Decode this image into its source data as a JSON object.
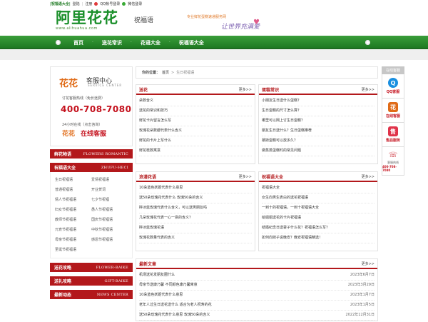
{
  "topbar": {
    "site_link": "|祝福语大全|",
    "login": "登陆",
    "sep": "|",
    "register": "注册",
    "qq_login": "QQ帐号登录",
    "wechat_login": "微信登录"
  },
  "logo": {
    "main": "阿里花花",
    "url": "www.alihuahua.com",
    "flower": "✿"
  },
  "header": {
    "site_name": "祝福语",
    "slogan": "专业鲜花蛋糕速递服务网",
    "banner_text": "让世界充满爱",
    "banner_heart": "♥"
  },
  "nav": {
    "items": [
      "首页",
      "送花常识",
      "花语大全",
      "祝福语大全"
    ],
    "dot": "·"
  },
  "service": {
    "logo": "花花",
    "title": "客服中心",
    "title_en": "SERVICE CENTER",
    "hotline_label": "订花客服热线（免长途费）",
    "phone": "400-708-7080",
    "online_label": "24小时在线（点击咨询）",
    "logo2": "花花",
    "online_btn": "在线客服"
  },
  "left_bars": [
    {
      "cn": "鲜花物语",
      "en": "FLOWERS ROMANTIC"
    },
    {
      "cn": "祝福语大全",
      "en": "ZHUFU-HECI"
    },
    {
      "cn": "送花攻略",
      "en": "FLOWER-BAIKE"
    },
    {
      "cn": "送礼攻略",
      "en": "GIFT-BAIKE"
    },
    {
      "cn": "最新动态",
      "en": "NEWS CENTER"
    }
  ],
  "tags": [
    "生日祝福语",
    "爱情祝福语",
    "普通祝福语",
    "开业贺词",
    "情人节祝福语",
    "七夕节祝福",
    "妇女节祝福语",
    "愚人节祝福语",
    "教师节祝福语",
    "国庆节祝福语",
    "元宵节祝福语",
    "中秋节祝福语",
    "母亲节祝福语",
    "感恩节祝福语",
    "圣诞节祝福语"
  ],
  "crumb": {
    "label": "你的位置：",
    "home": "首页",
    "arrow": ">",
    "current": "生日祝福语"
  },
  "more": "更多>>",
  "panels": [
    {
      "title": "送花",
      "items": [
        "朵数含义",
        "送花的常识和技巧",
        "鲜花卡片留言怎么写",
        "玫瑰花朵数都代表什么含义",
        "鲜花的卡片上写什么",
        "鲜花枝数寓意"
      ]
    },
    {
      "title": "蛋糕常识",
      "items": [
        "小朋友生日送什么蛋糕？",
        "生日蛋糕的尺寸怎么算？",
        "哪里可以网上订生日蛋糕？",
        "朋友生日送什么？生日蛋糕推荐",
        "慕斯蛋糕可以放多久？",
        "做蒸蒸蛋糕时的常见问题"
      ]
    },
    {
      "title": "浪漫花语",
      "items": [
        "10朵蓝色妖姬代表什么意思",
        "送50朵玫瑰花代表什么 玫瑰50朵的含义",
        "碎冰蓝玫瑰代表什么含义，可以送男朋友吗",
        "几朵玫瑰花代表一心一意的含义？",
        "碎冰蓝玫瑰花语",
        "玫瑰花数量代表的含义"
      ]
    },
    {
      "title": "祝福语大全",
      "items": [
        "祝福语大全",
        "女生向男生表白的送花祝福语",
        "一到十的祝福语，一到十祝福语大全",
        "给姐姐送花的卡片祝福语",
        "结婚纪念日送妻子什么花？祝福语怎么写？",
        "如何向妹子说晚安？晚安祝福语精选！"
      ]
    }
  ],
  "news": {
    "title": "最新文章",
    "items": [
      {
        "text": "机场送花发朋友圈什么",
        "date": "2023年6月7日"
      },
      {
        "text": "母亲节送康乃馨 不同颜色康乃馨寓意",
        "date": "2023年3月29日"
      },
      {
        "text": "10朵蓝色妖姬代表什么意思",
        "date": "2023年1月7日"
      },
      {
        "text": "老年人过生日送花送什么 适合为老人祝寿的花",
        "date": "2023年1月5日"
      },
      {
        "text": "送50朵玫瑰花代表什么意思 玫瑰50朵的含义",
        "date": "2022年12月31日"
      }
    ]
  },
  "rside": {
    "header": "在线客服",
    "qq": "QQ客服",
    "online": "在线客服",
    "after": "售后服务",
    "phone_label": "客服热线",
    "phone": "400-708-7080",
    "qq_icon": "Q",
    "logo_icon": "花",
    "after_icon": "售",
    "phone_icon": "☏"
  },
  "colors": {
    "brand_green": "#1e7a22",
    "accent_red": "#b3181b"
  }
}
